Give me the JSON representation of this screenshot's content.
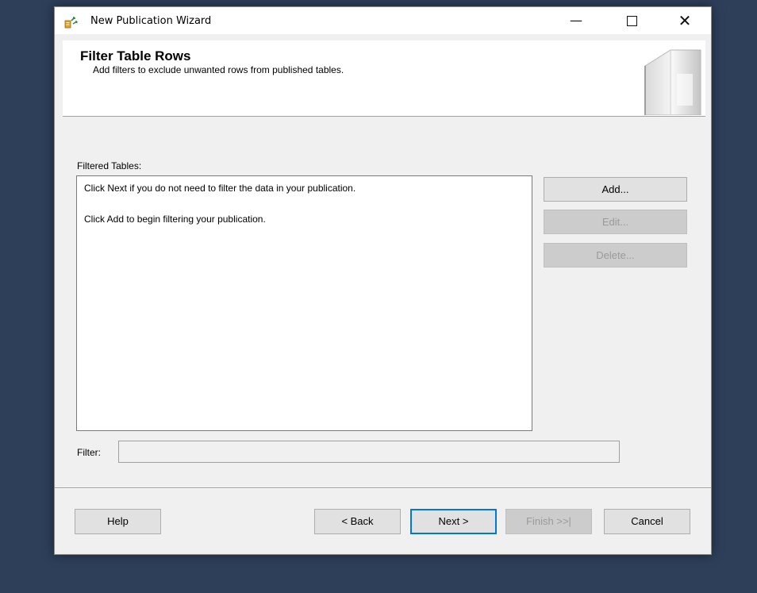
{
  "window": {
    "title": "New Publication Wizard",
    "controls": {
      "minimize": "—",
      "close": "✕"
    }
  },
  "header": {
    "title": "Filter Table Rows",
    "subtitle": "Add filters to exclude unwanted rows from published tables."
  },
  "filtered_tables": {
    "label": "Filtered Tables:",
    "lines": [
      "Click Next if you do not need to filter the data in your publication.",
      "Click Add to begin filtering your publication."
    ]
  },
  "side_buttons": {
    "add": "Add...",
    "edit": "Edit...",
    "delete": "Delete..."
  },
  "filter": {
    "label": "Filter:",
    "value": ""
  },
  "footer_buttons": {
    "help": "Help",
    "back": "< Back",
    "next": "Next >",
    "finish": "Finish >>|",
    "cancel": "Cancel"
  },
  "icons": {
    "app": "publication-wizard-icon",
    "header_graphic": "book-graphic-icon"
  }
}
